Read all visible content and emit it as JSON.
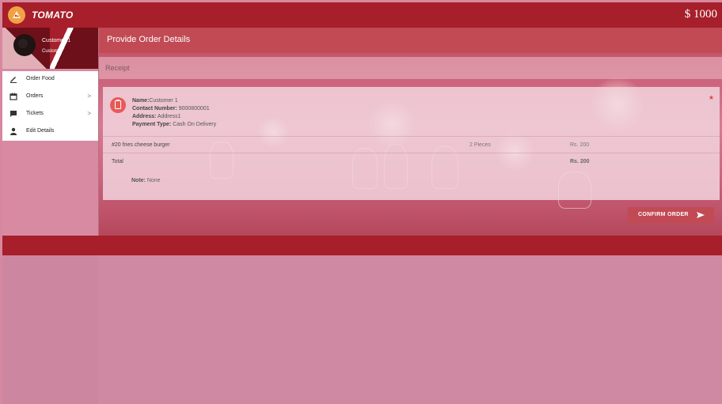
{
  "header": {
    "brand": "TOMATO",
    "balance": "$ 1000"
  },
  "profile": {
    "name": "Customer 1",
    "role": "Customer"
  },
  "sidebar": {
    "items": [
      {
        "label": "Order Food",
        "icon": "pencil-icon"
      },
      {
        "label": "Orders",
        "icon": "calendar-icon",
        "chevron": ">"
      },
      {
        "label": "Tickets",
        "icon": "chat-icon",
        "chevron": ">"
      },
      {
        "label": "Edit Details",
        "icon": "person-icon"
      }
    ]
  },
  "main": {
    "title": "Provide Order Details",
    "receipt_label": "Receipt",
    "order": {
      "name_label": "Name:",
      "name_value": "Customer 1",
      "contact_label": "Contact Number:",
      "contact_value": "9000800001",
      "address_label": "Address:",
      "address_value": "Address1",
      "payment_label": "Payment Type:",
      "payment_value": "Cash On Delivery",
      "star": "★"
    },
    "items": [
      {
        "name": "#20 fries cheese burger",
        "qty": "2 Pieces",
        "price": "Rs. 200"
      }
    ],
    "total": {
      "label": "Total",
      "value": "Rs. 200"
    },
    "note": {
      "label": "Note:",
      "value": "None"
    },
    "confirm_label": "CONFIRM ORDER"
  },
  "colors": {
    "brand_red": "#a61f2a",
    "accent": "#c14a55",
    "icon_red": "#e85a5a"
  }
}
